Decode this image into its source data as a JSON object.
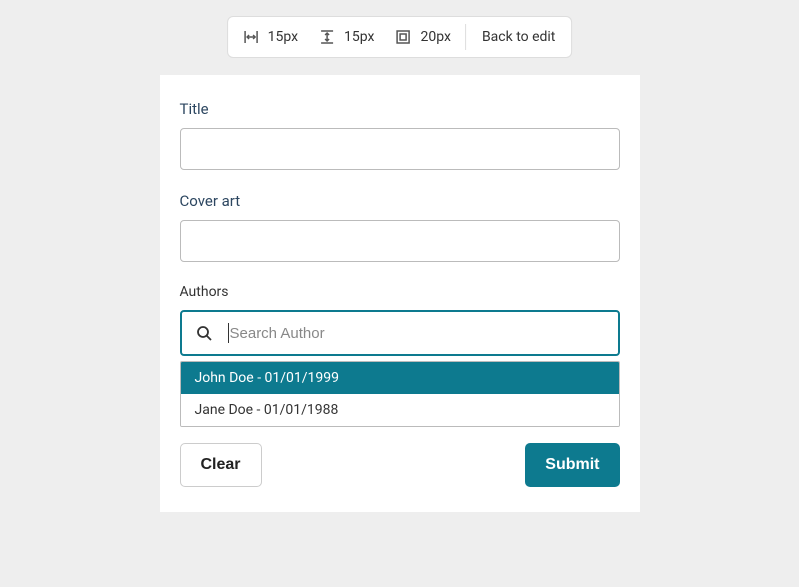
{
  "toolbar": {
    "hspace_value": "15px",
    "vspace_value": "15px",
    "padding_value": "20px",
    "back_label": "Back to edit"
  },
  "form": {
    "title_label": "Title",
    "title_value": "",
    "cover_label": "Cover art",
    "cover_value": "",
    "authors_label": "Authors",
    "search_placeholder": "Search Author",
    "search_value": "",
    "dropdown": [
      {
        "label": "John Doe - 01/01/1999",
        "highlighted": true
      },
      {
        "label": "Jane Doe - 01/01/1988",
        "highlighted": false
      }
    ],
    "clear_label": "Clear",
    "submit_label": "Submit"
  }
}
